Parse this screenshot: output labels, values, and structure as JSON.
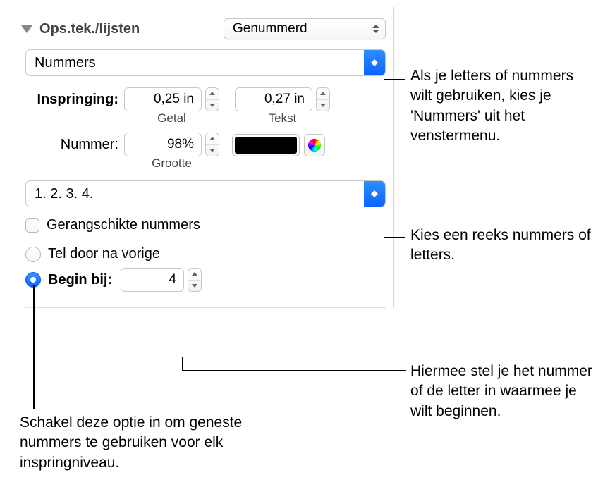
{
  "header": {
    "section_title": "Ops.tek./lijsten",
    "list_style": "Genummerd"
  },
  "numbers_popup": "Nummers",
  "indent": {
    "label": "Inspringing:",
    "number_value": "0,25 in",
    "number_caption": "Getal",
    "text_value": "0,27 in",
    "text_caption": "Tekst"
  },
  "number_style": {
    "label": "Nummer:",
    "size_value": "98%",
    "size_caption": "Grootte"
  },
  "sequence_popup": "1. 2. 3. 4.",
  "tiered": {
    "label": "Gerangschikte nummers"
  },
  "continue_radio": {
    "label": "Tel door na vorige"
  },
  "start_radio": {
    "label": "Begin bij:",
    "value": "4"
  },
  "callouts": {
    "c1": "Als je letters of nummers wilt gebruiken, kies je 'Nummers' uit het venstermenu.",
    "c2": "Kies een reeks nummers of letters.",
    "c3": "Hiermee stel je het nummer of de letter in waarmee je wilt beginnen.",
    "c4": "Schakel deze optie in om geneste nummers te gebruiken voor elk inspringniveau."
  }
}
